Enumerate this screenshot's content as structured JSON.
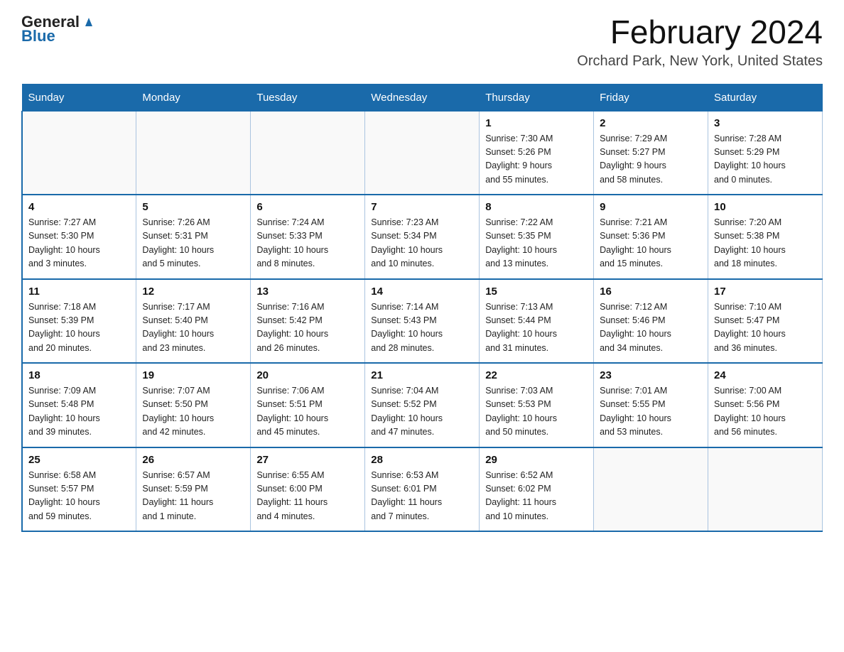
{
  "header": {
    "logo_general": "General",
    "logo_blue": "Blue",
    "month_title": "February 2024",
    "location": "Orchard Park, New York, United States"
  },
  "days_of_week": [
    "Sunday",
    "Monday",
    "Tuesday",
    "Wednesday",
    "Thursday",
    "Friday",
    "Saturday"
  ],
  "weeks": [
    [
      {
        "day": "",
        "info": ""
      },
      {
        "day": "",
        "info": ""
      },
      {
        "day": "",
        "info": ""
      },
      {
        "day": "",
        "info": ""
      },
      {
        "day": "1",
        "info": "Sunrise: 7:30 AM\nSunset: 5:26 PM\nDaylight: 9 hours\nand 55 minutes."
      },
      {
        "day": "2",
        "info": "Sunrise: 7:29 AM\nSunset: 5:27 PM\nDaylight: 9 hours\nand 58 minutes."
      },
      {
        "day": "3",
        "info": "Sunrise: 7:28 AM\nSunset: 5:29 PM\nDaylight: 10 hours\nand 0 minutes."
      }
    ],
    [
      {
        "day": "4",
        "info": "Sunrise: 7:27 AM\nSunset: 5:30 PM\nDaylight: 10 hours\nand 3 minutes."
      },
      {
        "day": "5",
        "info": "Sunrise: 7:26 AM\nSunset: 5:31 PM\nDaylight: 10 hours\nand 5 minutes."
      },
      {
        "day": "6",
        "info": "Sunrise: 7:24 AM\nSunset: 5:33 PM\nDaylight: 10 hours\nand 8 minutes."
      },
      {
        "day": "7",
        "info": "Sunrise: 7:23 AM\nSunset: 5:34 PM\nDaylight: 10 hours\nand 10 minutes."
      },
      {
        "day": "8",
        "info": "Sunrise: 7:22 AM\nSunset: 5:35 PM\nDaylight: 10 hours\nand 13 minutes."
      },
      {
        "day": "9",
        "info": "Sunrise: 7:21 AM\nSunset: 5:36 PM\nDaylight: 10 hours\nand 15 minutes."
      },
      {
        "day": "10",
        "info": "Sunrise: 7:20 AM\nSunset: 5:38 PM\nDaylight: 10 hours\nand 18 minutes."
      }
    ],
    [
      {
        "day": "11",
        "info": "Sunrise: 7:18 AM\nSunset: 5:39 PM\nDaylight: 10 hours\nand 20 minutes."
      },
      {
        "day": "12",
        "info": "Sunrise: 7:17 AM\nSunset: 5:40 PM\nDaylight: 10 hours\nand 23 minutes."
      },
      {
        "day": "13",
        "info": "Sunrise: 7:16 AM\nSunset: 5:42 PM\nDaylight: 10 hours\nand 26 minutes."
      },
      {
        "day": "14",
        "info": "Sunrise: 7:14 AM\nSunset: 5:43 PM\nDaylight: 10 hours\nand 28 minutes."
      },
      {
        "day": "15",
        "info": "Sunrise: 7:13 AM\nSunset: 5:44 PM\nDaylight: 10 hours\nand 31 minutes."
      },
      {
        "day": "16",
        "info": "Sunrise: 7:12 AM\nSunset: 5:46 PM\nDaylight: 10 hours\nand 34 minutes."
      },
      {
        "day": "17",
        "info": "Sunrise: 7:10 AM\nSunset: 5:47 PM\nDaylight: 10 hours\nand 36 minutes."
      }
    ],
    [
      {
        "day": "18",
        "info": "Sunrise: 7:09 AM\nSunset: 5:48 PM\nDaylight: 10 hours\nand 39 minutes."
      },
      {
        "day": "19",
        "info": "Sunrise: 7:07 AM\nSunset: 5:50 PM\nDaylight: 10 hours\nand 42 minutes."
      },
      {
        "day": "20",
        "info": "Sunrise: 7:06 AM\nSunset: 5:51 PM\nDaylight: 10 hours\nand 45 minutes."
      },
      {
        "day": "21",
        "info": "Sunrise: 7:04 AM\nSunset: 5:52 PM\nDaylight: 10 hours\nand 47 minutes."
      },
      {
        "day": "22",
        "info": "Sunrise: 7:03 AM\nSunset: 5:53 PM\nDaylight: 10 hours\nand 50 minutes."
      },
      {
        "day": "23",
        "info": "Sunrise: 7:01 AM\nSunset: 5:55 PM\nDaylight: 10 hours\nand 53 minutes."
      },
      {
        "day": "24",
        "info": "Sunrise: 7:00 AM\nSunset: 5:56 PM\nDaylight: 10 hours\nand 56 minutes."
      }
    ],
    [
      {
        "day": "25",
        "info": "Sunrise: 6:58 AM\nSunset: 5:57 PM\nDaylight: 10 hours\nand 59 minutes."
      },
      {
        "day": "26",
        "info": "Sunrise: 6:57 AM\nSunset: 5:59 PM\nDaylight: 11 hours\nand 1 minute."
      },
      {
        "day": "27",
        "info": "Sunrise: 6:55 AM\nSunset: 6:00 PM\nDaylight: 11 hours\nand 4 minutes."
      },
      {
        "day": "28",
        "info": "Sunrise: 6:53 AM\nSunset: 6:01 PM\nDaylight: 11 hours\nand 7 minutes."
      },
      {
        "day": "29",
        "info": "Sunrise: 6:52 AM\nSunset: 6:02 PM\nDaylight: 11 hours\nand 10 minutes."
      },
      {
        "day": "",
        "info": ""
      },
      {
        "day": "",
        "info": ""
      }
    ]
  ]
}
